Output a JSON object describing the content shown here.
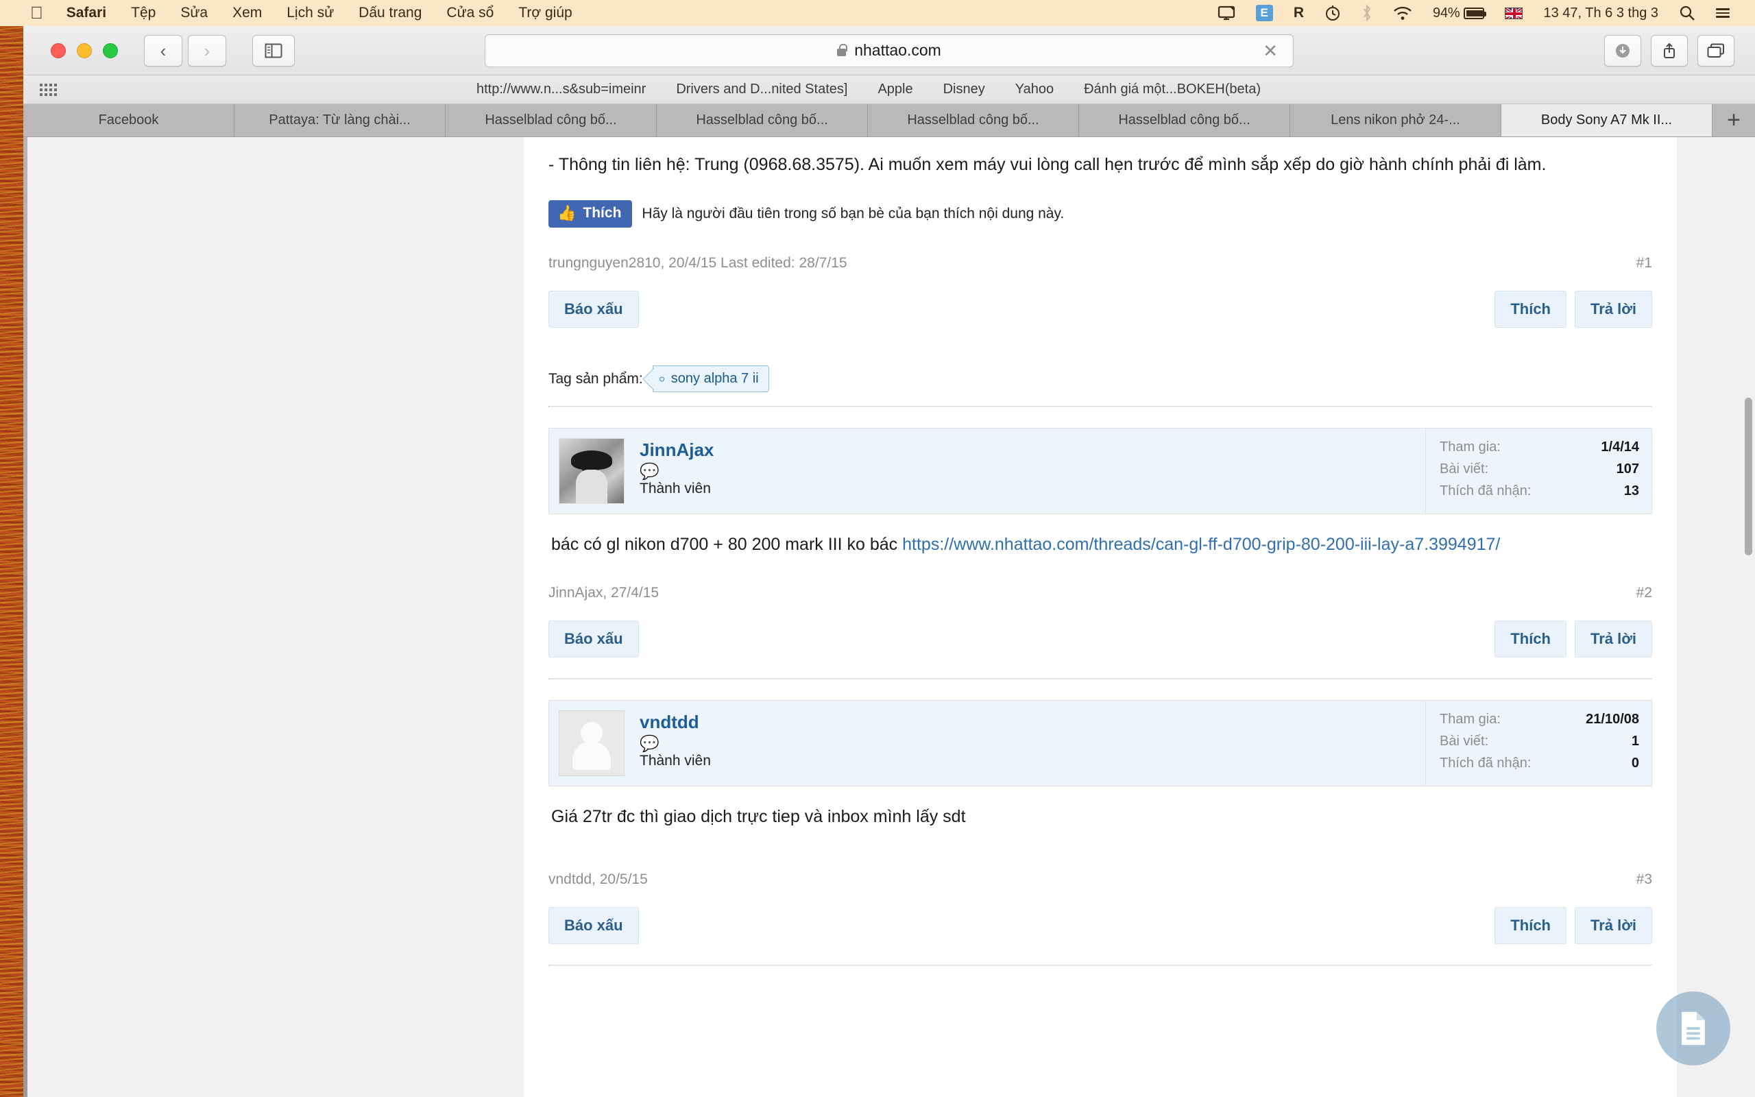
{
  "menubar": {
    "apple_icon": "apple-icon",
    "items": [
      "Safari",
      "Tệp",
      "Sửa",
      "Xem",
      "Lịch sử",
      "Dấu trang",
      "Cửa sổ",
      "Trợ giúp"
    ],
    "status": {
      "airplay_icon": "airplay-display-icon",
      "evernote_icon": "evernote-icon",
      "r_icon": "R",
      "timemachine_icon": "time-machine-clock-icon",
      "bluetooth_icon": "bluetooth-icon",
      "wifi_icon": "wifi-icon",
      "battery_percent": "94%",
      "flag_icon": "uk-flag-icon",
      "clock": "13 47, Th 6 3 thg 3",
      "search_icon": "spotlight-search-icon",
      "notification_icon": "notification-center-icon"
    }
  },
  "toolbar": {
    "back_icon": "chevron-left-icon",
    "forward_icon": "chevron-right-icon",
    "sidebar_icon": "show-sidebar-icon",
    "lock_icon": "lock-icon",
    "url": "nhattao.com",
    "clear_icon": "clear-x-icon",
    "download_icon": "download-icon",
    "share_icon": "share-icon",
    "tabs_icon": "show-all-tabs-icon"
  },
  "bookmarks": {
    "apps_icon": "apps-grid-icon",
    "items": [
      "http://www.n...s&sub=imeinr",
      "Drivers and D...nited States]",
      "Apple",
      "Disney",
      "Yahoo",
      "Đánh giá một...BOKEH(beta)"
    ]
  },
  "tabs": {
    "items": [
      {
        "label": "Facebook",
        "active": false
      },
      {
        "label": "Pattaya: Từ làng chài...",
        "active": false
      },
      {
        "label": "Hasselblad công bố...",
        "active": false
      },
      {
        "label": "Hasselblad công bố...",
        "active": false
      },
      {
        "label": "Hasselblad công bố...",
        "active": false
      },
      {
        "label": "Hasselblad công bố...",
        "active": false
      },
      {
        "label": "Lens nikon phở 24-...",
        "active": false
      },
      {
        "label": "Body Sony A7 Mk II...",
        "active": true
      }
    ],
    "new_tab_icon": "plus-icon"
  },
  "thread": {
    "first_post": {
      "body": "- Thông tin liên hệ: Trung (0968.68.3575). Ai muốn xem máy vui lòng call hẹn trước để mình sắp xếp do giờ hành chính phải đi làm.",
      "fb_like_label": "Thích",
      "fb_like_icon": "thumbs-up-icon",
      "fb_like_text": "Hãy là người đầu tiên trong số bạn bè của bạn thích nội dung này.",
      "meta": "trungnguyen2810, 20/4/15  Last edited: 28/7/15",
      "post_number": "#1",
      "report_label": "Báo xấu",
      "like_label": "Thích",
      "reply_label": "Trả lời"
    },
    "tags": {
      "label": "Tag sản phẩm:",
      "chip": "sony alpha 7 ii"
    },
    "posts": [
      {
        "username": "JinnAjax",
        "avatar_type": "photo",
        "bubble_icon": "conversation-bubble-icon",
        "user_title": "Thành viên",
        "stats": [
          {
            "label": "Tham gia:",
            "value": "1/4/14"
          },
          {
            "label": "Bài viết:",
            "value": "107"
          },
          {
            "label": "Thích đã nhận:",
            "value": "13"
          }
        ],
        "text": "bác có gl nikon d700 + 80 200 mark III ko bác ",
        "link": "https://www.nhattao.com/threads/can-gl-ff-d700-grip-80-200-iii-lay-a7.3994917/",
        "meta": "JinnAjax, 27/4/15",
        "post_number": "#2",
        "report_label": "Báo xấu",
        "like_label": "Thích",
        "reply_label": "Trả lời"
      },
      {
        "username": "vndtdd",
        "avatar_type": "silhouette",
        "bubble_icon": "conversation-bubble-icon",
        "user_title": "Thành viên",
        "stats": [
          {
            "label": "Tham gia:",
            "value": "21/10/08"
          },
          {
            "label": "Bài viết:",
            "value": "1"
          },
          {
            "label": "Thích đã nhận:",
            "value": "0"
          }
        ],
        "text": "Giá 27tr đc thì giao dịch trực tiep và inbox mình lấy sdt",
        "link": "",
        "meta": "vndtdd, 20/5/15",
        "post_number": "#3",
        "report_label": "Báo xấu",
        "like_label": "Thích",
        "reply_label": "Trả lời"
      }
    ],
    "floating_button_icon": "document-icon"
  },
  "colors": {
    "menubar_bg": "#fbe7c6",
    "link": "#2f6fad",
    "username": "#1c5d96",
    "fb_blue": "#4267b2",
    "button_bg": "#eaf3fb",
    "post_head_bg": "#edf4fb",
    "wallpaper": "#b8441c"
  }
}
